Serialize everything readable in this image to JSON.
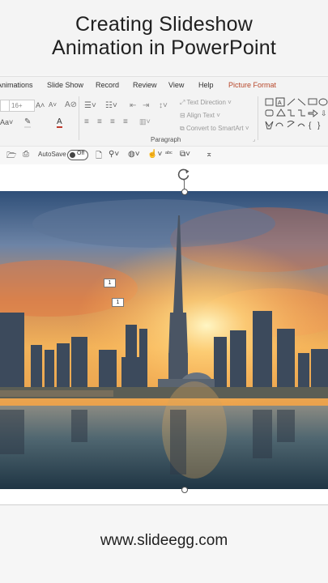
{
  "title": {
    "line1": "Creating Slideshow",
    "line2": "Animation in PowerPoint"
  },
  "ribbon": {
    "tabs": [
      {
        "label": "Animations"
      },
      {
        "label": "Slide Show"
      },
      {
        "label": "Record"
      },
      {
        "label": "Review"
      },
      {
        "label": "View"
      },
      {
        "label": "Help"
      },
      {
        "label": "Picture Format"
      }
    ],
    "font_size": "16+",
    "text_direction": "Text Direction",
    "align_text": "Align Text",
    "convert_smartart": "Convert to SmartArt",
    "paragraph_label": "Paragraph"
  },
  "qat": {
    "autosave_label": "AutoSave",
    "autosave_state": "Off"
  },
  "slide": {
    "badge1": "1",
    "badge2": "1"
  },
  "footer": {
    "url": "www.slideegg.com"
  },
  "colors": {
    "accent_tab": "#b7472a",
    "footer_text": "#1f1f1f"
  }
}
